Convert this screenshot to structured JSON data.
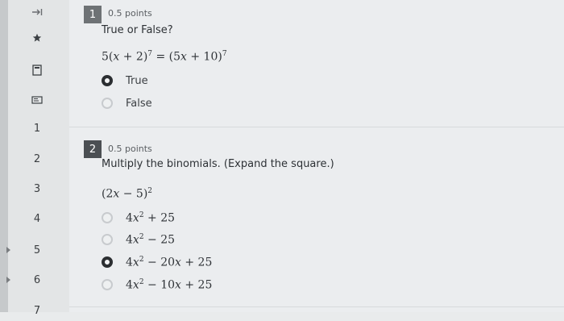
{
  "sidebar": {
    "items": [
      {
        "label": "1"
      },
      {
        "label": "2"
      },
      {
        "label": "3"
      },
      {
        "label": "4"
      },
      {
        "label": "5"
      },
      {
        "label": "6"
      },
      {
        "label": "7"
      }
    ]
  },
  "questions": [
    {
      "number": "1",
      "points": "0.5 points",
      "prompt": "True or False?",
      "math": "5(x + 2)^7 = (5x + 10)^7",
      "options": [
        {
          "label": "True",
          "selected": true
        },
        {
          "label": "False",
          "selected": false
        }
      ]
    },
    {
      "number": "2",
      "points": "0.5 points",
      "prompt": "Multiply the binomials. (Expand the square.)",
      "math": "(2x − 5)^2",
      "options": [
        {
          "label": "4x^2 + 25",
          "selected": false
        },
        {
          "label": "4x^2 − 25",
          "selected": false
        },
        {
          "label": "4x^2 − 20x + 25",
          "selected": true
        },
        {
          "label": "4x^2 − 10x + 25",
          "selected": false
        }
      ]
    }
  ]
}
